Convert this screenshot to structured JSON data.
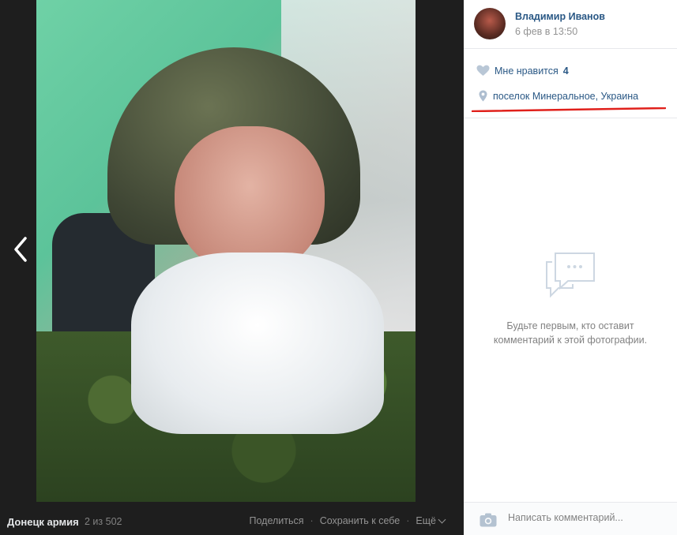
{
  "photo_pane": {
    "album_name": "Донецк армия",
    "counter": "2 из 502",
    "actions": {
      "share": "Поделиться",
      "save": "Сохранить к себе",
      "more": "Ещё"
    }
  },
  "sidebar": {
    "author_name": "Владимир Иванов",
    "post_date": "6 фев в 13:50",
    "likes": {
      "label": "Мне нравится",
      "count": "4"
    },
    "location": "поселок Минеральное, Украина",
    "empty_comments": {
      "line1": "Будьте первым, кто оставит",
      "line2": "комментарий к этой фотографии."
    },
    "comment_placeholder": "Написать комментарий..."
  },
  "colors": {
    "link": "#2a5885",
    "muted": "#828282",
    "dark_bg": "#1e1e1e",
    "annotation_red": "#e0201b"
  }
}
